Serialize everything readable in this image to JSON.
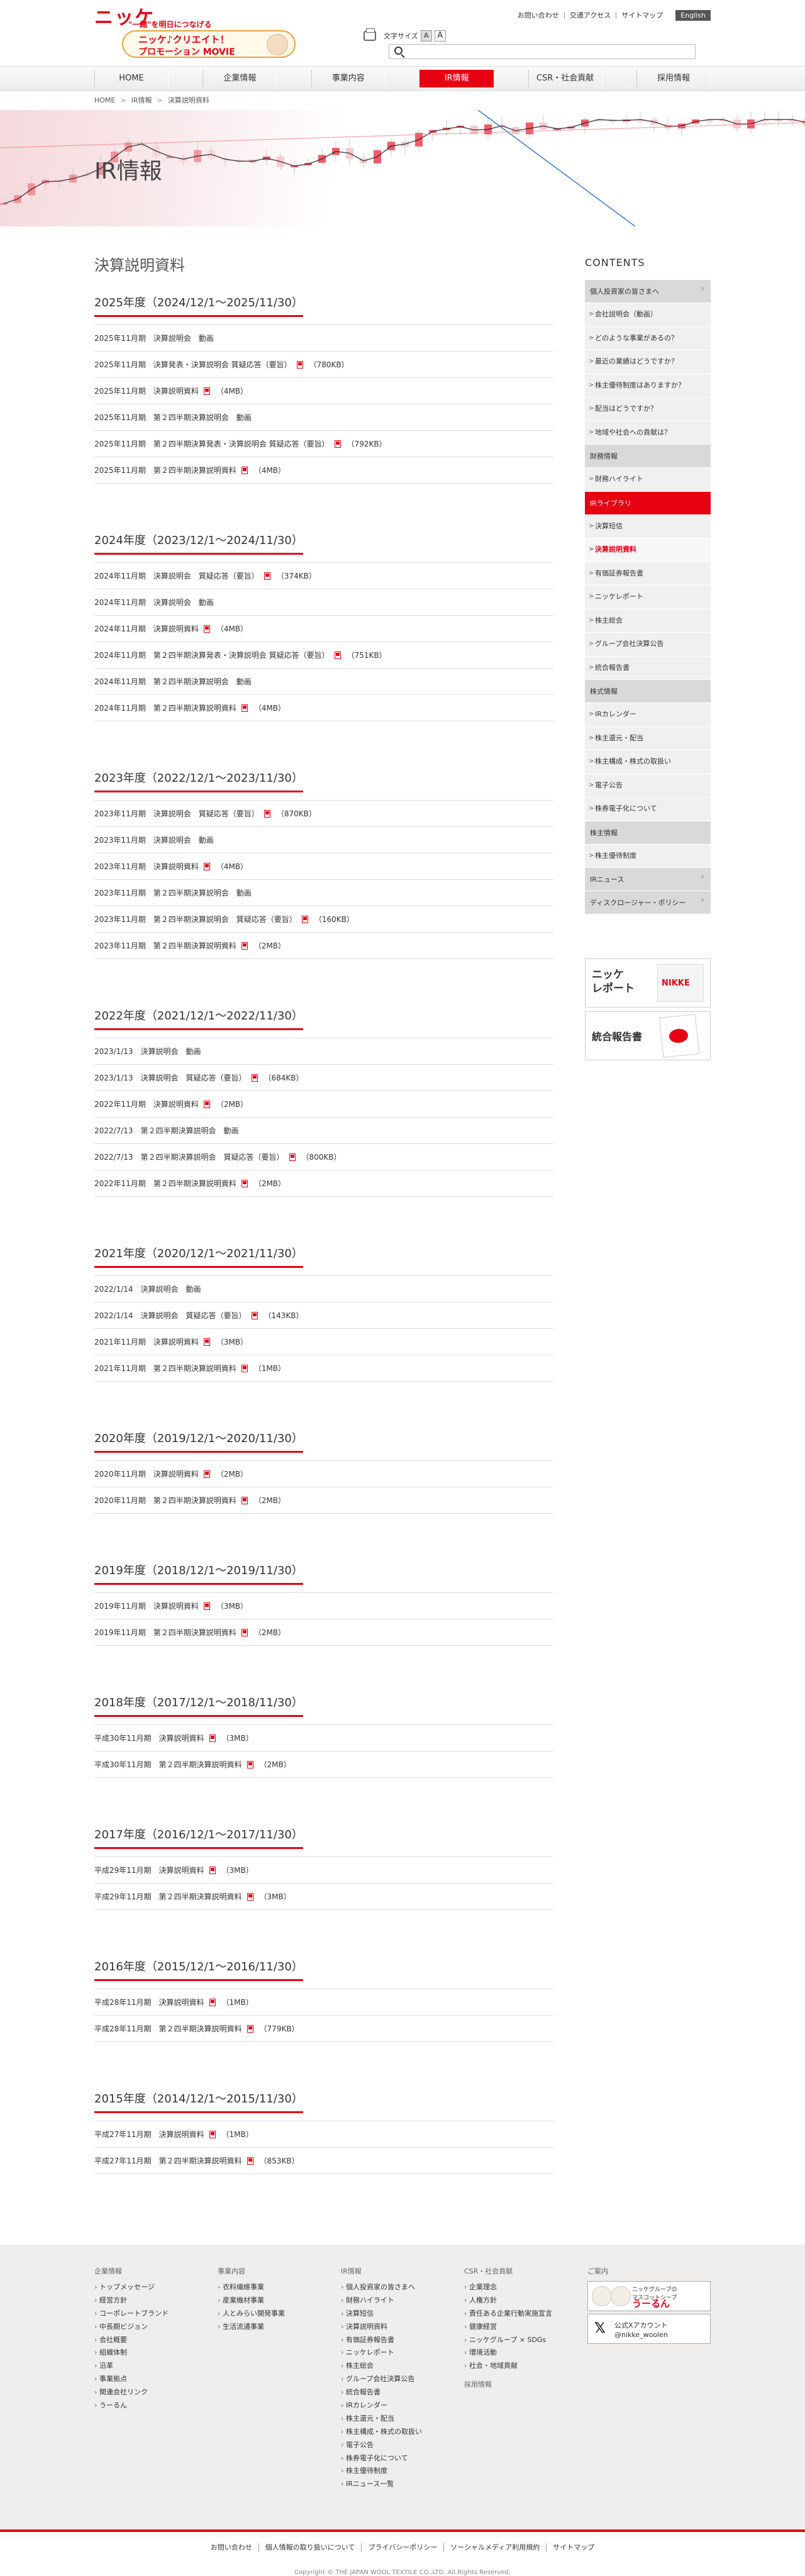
{
  "header": {
    "logo": "ニッケ",
    "promo_tagline": "\"一緒\"を明日につなげる",
    "promo_line1": "ニッケ♪クリエイト！",
    "promo_line2": "プロモーション MOVIE",
    "utility_links": [
      "お問い合わせ",
      "交通アクセス",
      "サイトマップ"
    ],
    "english": "English",
    "fontsize_label": "文字サイズ",
    "fontsize_options": [
      "A",
      "A"
    ]
  },
  "gnav": [
    "HOME",
    "企業情報",
    "事業内容",
    "IR情報",
    "CSR・社会貢献",
    "採用情報"
  ],
  "breadcrumb": [
    "HOME",
    "IR情報",
    "決算説明資料"
  ],
  "hero_title": "IR情報",
  "page_title": "決算説明資料",
  "fiscal_years": [
    {
      "title": "2025年度（2024/12/1～2025/11/30）",
      "items": [
        {
          "text": "2025年11月期　決算説明会　動画",
          "pdf": false,
          "size": ""
        },
        {
          "text": "2025年11月期　決算発表・決算説明会 質疑応答（要旨）",
          "pdf": true,
          "size": "（780KB）"
        },
        {
          "text": "2025年11月期　決算説明資料",
          "pdf": true,
          "size": "（4MB）"
        },
        {
          "text": "2025年11月期　第２四半期決算説明会　動画",
          "pdf": false,
          "size": ""
        },
        {
          "text": "2025年11月期　第２四半期決算発表・決算説明会 質疑応答（要旨）",
          "pdf": true,
          "size": "（792KB）"
        },
        {
          "text": "2025年11月期　第２四半期決算説明資料",
          "pdf": true,
          "size": "（4MB）"
        }
      ]
    },
    {
      "title": "2024年度（2023/12/1～2024/11/30）",
      "items": [
        {
          "text": "2024年11月期　決算説明会　質疑応答（要旨）",
          "pdf": true,
          "size": "（374KB）"
        },
        {
          "text": "2024年11月期　決算説明会　動画",
          "pdf": false,
          "size": ""
        },
        {
          "text": "2024年11月期　決算説明資料",
          "pdf": true,
          "size": "（4MB）"
        },
        {
          "text": "2024年11月期　第２四半期決算発表・決算説明会 質疑応答（要旨）",
          "pdf": true,
          "size": "（751KB）"
        },
        {
          "text": "2024年11月期　第２四半期決算説明会　動画",
          "pdf": false,
          "size": ""
        },
        {
          "text": "2024年11月期　第２四半期決算説明資料",
          "pdf": true,
          "size": "（4MB）"
        }
      ]
    },
    {
      "title": "2023年度（2022/12/1～2023/11/30）",
      "items": [
        {
          "text": "2023年11月期　決算説明会　質疑応答（要旨）",
          "pdf": true,
          "size": "（870KB）"
        },
        {
          "text": "2023年11月期　決算説明会　動画",
          "pdf": false,
          "size": ""
        },
        {
          "text": "2023年11月期　決算説明資料",
          "pdf": true,
          "size": "（4MB）"
        },
        {
          "text": "2023年11月期　第２四半期決算説明会　動画",
          "pdf": false,
          "size": ""
        },
        {
          "text": "2023年11月期　第２四半期決算説明会　質疑応答（要旨）",
          "pdf": true,
          "size": "（160KB）"
        },
        {
          "text": "2023年11月期　第２四半期決算説明資料",
          "pdf": true,
          "size": "（2MB）"
        }
      ]
    },
    {
      "title": "2022年度（2021/12/1～2022/11/30）",
      "items": [
        {
          "text": "2023/1/13　決算説明会　動画",
          "pdf": false,
          "size": ""
        },
        {
          "text": "2023/1/13　決算説明会　質疑応答（要旨）",
          "pdf": true,
          "size": "（684KB）"
        },
        {
          "text": "2022年11月期　決算説明資料",
          "pdf": true,
          "size": "（2MB）"
        },
        {
          "text": "2022/7/13　第２四半期決算説明会　動画",
          "pdf": false,
          "size": ""
        },
        {
          "text": "2022/7/13　第２四半期決算説明会　質疑応答（要旨）",
          "pdf": true,
          "size": "（800KB）"
        },
        {
          "text": "2022年11月期　第２四半期決算説明資料",
          "pdf": true,
          "size": "（2MB）"
        }
      ]
    },
    {
      "title": "2021年度（2020/12/1～2021/11/30）",
      "items": [
        {
          "text": "2022/1/14　決算説明会　動画",
          "pdf": false,
          "size": ""
        },
        {
          "text": "2022/1/14　決算説明会　質疑応答（要旨）",
          "pdf": true,
          "size": "（143KB）"
        },
        {
          "text": "2021年11月期　決算説明資料",
          "pdf": true,
          "size": "（3MB）"
        },
        {
          "text": "2021年11月期　第２四半期決算説明資料",
          "pdf": true,
          "size": "（1MB）"
        }
      ]
    },
    {
      "title": "2020年度（2019/12/1～2020/11/30）",
      "items": [
        {
          "text": "2020年11月期　決算説明資料",
          "pdf": true,
          "size": "（2MB）"
        },
        {
          "text": "2020年11月期　第２四半期決算説明資料",
          "pdf": true,
          "size": "（2MB）"
        }
      ]
    },
    {
      "title": "2019年度（2018/12/1～2019/11/30）",
      "items": [
        {
          "text": "2019年11月期　決算説明資料",
          "pdf": true,
          "size": "（3MB）"
        },
        {
          "text": "2019年11月期　第２四半期決算説明資料",
          "pdf": true,
          "size": "（2MB）"
        }
      ]
    },
    {
      "title": "2018年度（2017/12/1～2018/11/30）",
      "items": [
        {
          "text": "平成30年11月期　決算説明資料",
          "pdf": true,
          "size": "（3MB）"
        },
        {
          "text": "平成30年11月期　第２四半期決算説明資料",
          "pdf": true,
          "size": "（2MB）"
        }
      ]
    },
    {
      "title": "2017年度（2016/12/1～2017/11/30）",
      "items": [
        {
          "text": "平成29年11月期　決算説明資料",
          "pdf": true,
          "size": "（3MB）"
        },
        {
          "text": "平成29年11月期　第２四半期決算説明資料",
          "pdf": true,
          "size": "（3MB）"
        }
      ]
    },
    {
      "title": "2016年度（2015/12/1～2016/11/30）",
      "items": [
        {
          "text": "平成28年11月期　決算説明資料",
          "pdf": true,
          "size": "（1MB）"
        },
        {
          "text": "平成28年11月期　第２四半期決算説明資料",
          "pdf": true,
          "size": "（779KB）"
        }
      ]
    },
    {
      "title": "2015年度（2014/12/1～2015/11/30）",
      "items": [
        {
          "text": "平成27年11月期　決算説明資料",
          "pdf": true,
          "size": "（1MB）"
        },
        {
          "text": "平成27年11月期　第２四半期決算説明資料",
          "pdf": true,
          "size": "（853KB）"
        }
      ]
    }
  ],
  "sidebar": {
    "title": "CONTENTS",
    "items": [
      {
        "kind": "head",
        "label": "個人投資家の皆さまへ",
        "chev": true
      },
      {
        "kind": "item",
        "label": "会社説明会（動画）"
      },
      {
        "kind": "item",
        "label": "どのような事業があるの？"
      },
      {
        "kind": "item",
        "label": "最近の業績はどうですか？"
      },
      {
        "kind": "item",
        "label": "株主優待制度はありますか？"
      },
      {
        "kind": "item",
        "label": "配当はどうですか？"
      },
      {
        "kind": "item",
        "label": "地域や社会への貢献は？"
      },
      {
        "kind": "head",
        "label": "財務情報",
        "chev": false
      },
      {
        "kind": "item",
        "label": "財務ハイライト"
      },
      {
        "kind": "head-red",
        "label": "IRライブラリ",
        "chev": false
      },
      {
        "kind": "item",
        "label": "決算短信"
      },
      {
        "kind": "current",
        "label": "決算説明資料"
      },
      {
        "kind": "item",
        "label": "有価証券報告書"
      },
      {
        "kind": "item",
        "label": "ニッケレポート"
      },
      {
        "kind": "item",
        "label": "株主総会"
      },
      {
        "kind": "item",
        "label": "グループ会社決算公告"
      },
      {
        "kind": "item",
        "label": "統合報告書"
      },
      {
        "kind": "head",
        "label": "株式情報",
        "chev": false
      },
      {
        "kind": "item",
        "label": "IRカレンダー"
      },
      {
        "kind": "item",
        "label": "株主還元・配当"
      },
      {
        "kind": "item",
        "label": "株主構成・株式の取扱い"
      },
      {
        "kind": "item",
        "label": "電子公告"
      },
      {
        "kind": "item",
        "label": "株券電子化について"
      },
      {
        "kind": "head",
        "label": "株主情報",
        "chev": false
      },
      {
        "kind": "item",
        "label": "株主優待制度"
      },
      {
        "kind": "head",
        "label": "IRニュース",
        "chev": true
      },
      {
        "kind": "head",
        "label": "ディスクロージャー・ポリシー",
        "chev": true
      }
    ],
    "banner1_title": "ニッケ\nレポート",
    "banner1_img_label": "NIKKE",
    "banner2_title": "統合報告書"
  },
  "footer": {
    "columns": [
      {
        "title": "企業情報",
        "items": [
          "トップメッセージ",
          "経営方針",
          "コーポレートブランド",
          "中長期ビジョン",
          "会社概要",
          "組織体制",
          "沿革",
          "事業拠点",
          "関連会社リンク",
          "うーるん"
        ]
      },
      {
        "title": "事業内容",
        "items": [
          "衣料繊維事業",
          "産業機材事業",
          "人とみらい開発事業",
          "生活流通事業"
        ]
      },
      {
        "title": "IR情報",
        "items": [
          "個人投資家の皆さまへ",
          "財務ハイライト",
          "決算短信",
          "決算説明資料",
          "有価証券報告書",
          "ニッケレポート",
          "株主総会",
          "グループ会社決算公告",
          "統合報告書",
          "IRカレンダー",
          "株主還元・配当",
          "株主構成・株式の取扱い",
          "電子公告",
          "株券電子化について",
          "株主優待制度",
          "IRニュース一覧"
        ]
      },
      {
        "title": "CSR・社会貢献",
        "items": [
          "企業理念",
          "人権方針",
          "責任ある企業行動実施宣言",
          "健康経営",
          "ニッケグループ × SDGs",
          "環境活動",
          "社会・地域貢献"
        ],
        "subtitle": "採用情報"
      }
    ],
    "guide_title": "ご案内",
    "mascot_line1": "ニッケグループの\nマスコットシープ",
    "mascot_name": "うーるん",
    "x_line1": "公式Xアカウント",
    "x_line2": "@nikke_woolen",
    "bottom_links": [
      "お問い合わせ",
      "個人情報の取り扱いについて",
      "プライバシーポリシー",
      "ソーシャルメディア利用規約",
      "サイトマップ"
    ],
    "copyright": "Copyright © THE JAPAN WOOL TEXTILE CO.,LTD. All Rights Reserved."
  }
}
